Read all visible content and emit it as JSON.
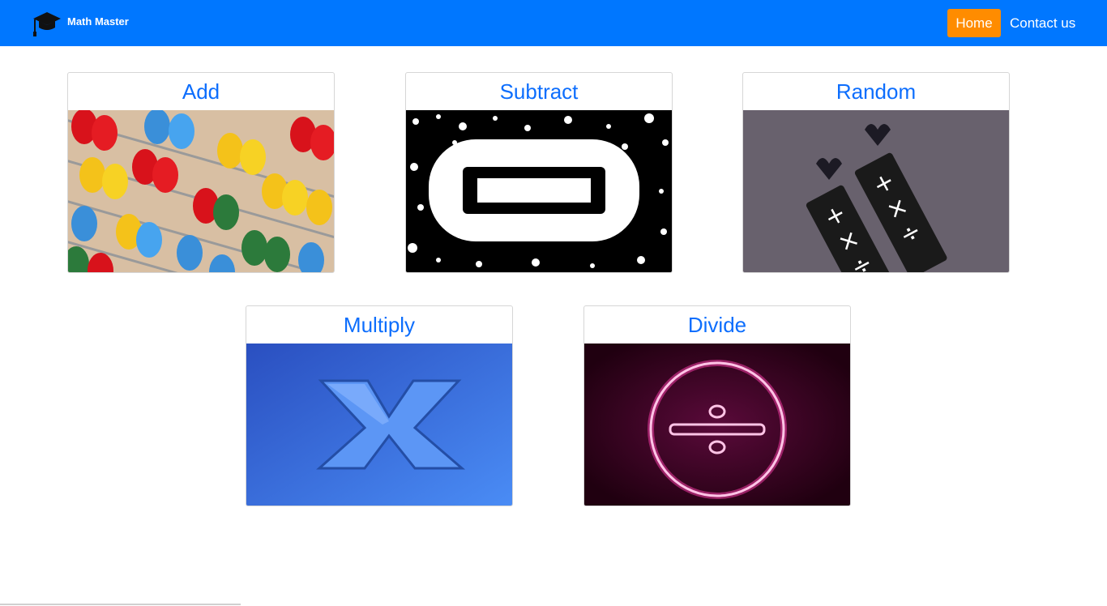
{
  "navbar": {
    "brand_icon": "graduation-cap-icon",
    "brand_name": "Math Master",
    "home_label": "Home",
    "contact_label": "Contact us",
    "colors": {
      "bar": "#0077ff",
      "active": "#ff8c00",
      "text": "#ffffff"
    }
  },
  "cards": [
    {
      "title": "Add",
      "image": "abacus-beads-image"
    },
    {
      "title": "Subtract",
      "image": "minus-sign-image"
    },
    {
      "title": "Random",
      "image": "math-symbols-earrings-image"
    },
    {
      "title": "Multiply",
      "image": "multiply-sign-image"
    },
    {
      "title": "Divide",
      "image": "neon-divide-sign-image"
    }
  ],
  "title_color": "#0d6efd"
}
